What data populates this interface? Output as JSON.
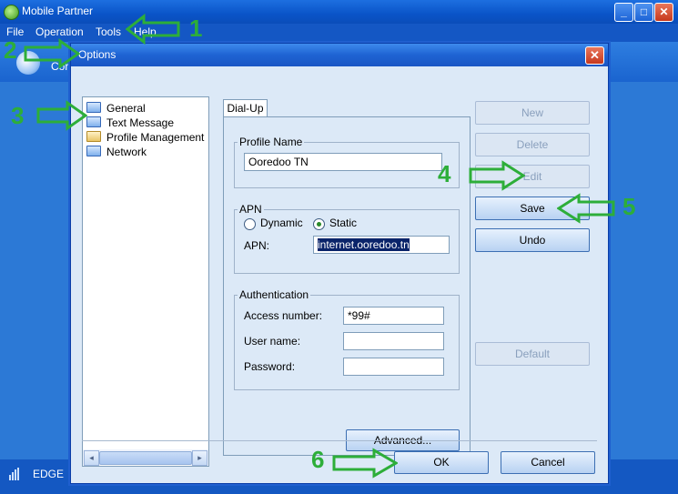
{
  "app": {
    "title": "Mobile Partner",
    "toolbar_label": "Cor"
  },
  "menu": [
    "File",
    "Operation",
    "Tools",
    "Help"
  ],
  "window_controls": {
    "minimize": "_",
    "maximize": "□",
    "close": "✕"
  },
  "status": {
    "network": "EDGE"
  },
  "dialog": {
    "title": "Options",
    "close": "✕",
    "tree": [
      "General",
      "Text Message",
      "Profile Management",
      "Network"
    ],
    "tab": "Dial-Up",
    "profile": {
      "legend": "Profile Name",
      "value": "Ooredoo TN"
    },
    "apn": {
      "legend": "APN",
      "dynamic_label": "Dynamic",
      "static_label": "Static",
      "selected": "Static",
      "field_label": "APN:",
      "value": "internet.ooredoo.tn"
    },
    "auth": {
      "legend": "Authentication",
      "access_label": "Access number:",
      "access_value": "*99#",
      "user_label": "User name:",
      "user_value": "",
      "password_label": "Password:",
      "password_value": ""
    },
    "buttons": {
      "new": "New",
      "delete": "Delete",
      "edit": "Edit",
      "save": "Save",
      "undo": "Undo",
      "default": "Default",
      "advanced": "Advanced...",
      "ok": "OK",
      "cancel": "Cancel"
    }
  },
  "annotations": [
    "1",
    "2",
    "3",
    "4",
    "5",
    "6"
  ],
  "colors": {
    "annotation_green": "#2dae39",
    "title_blue": "#1a56c4",
    "panel_bg": "#dce9f7"
  }
}
